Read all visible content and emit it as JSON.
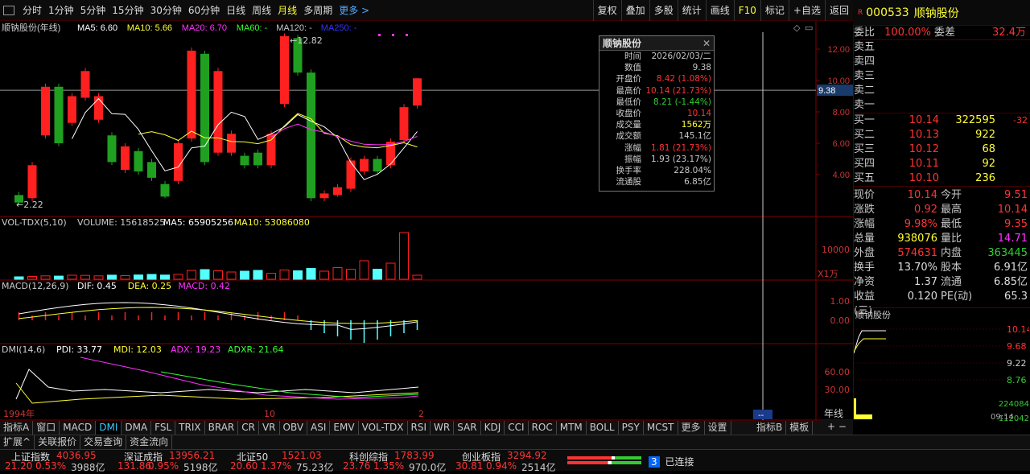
{
  "toolbar": {
    "periods": [
      "分时",
      "1分钟",
      "5分钟",
      "15分钟",
      "30分钟",
      "60分钟",
      "日线",
      "周线",
      "月线",
      "多周期",
      "更多 >"
    ],
    "selected": "月线",
    "tools": [
      "复权",
      "叠加",
      "多股",
      "统计",
      "画线",
      "F10",
      "标记",
      "+自选",
      "返回"
    ]
  },
  "stock": {
    "code": "000533",
    "name": "顺钠股份",
    "flag": "R"
  },
  "main_panel": {
    "title": "顺钠股份(年线)",
    "ma": [
      {
        "label": "MA5: 6.60",
        "color": "#ffffff"
      },
      {
        "label": "MA10: 5.66",
        "color": "#ffff33"
      },
      {
        "label": "MA20: 6.70",
        "color": "#ff33ff"
      },
      {
        "label": "MA60: -",
        "color": "#33ff33"
      },
      {
        "label": "MA120: -",
        "color": "#c8c8c8"
      },
      {
        "label": "MA250: -",
        "color": "#3333ff"
      }
    ],
    "high_label": "12.82",
    "low_label": "2.22",
    "y_ticks": [
      "12.00",
      "10.00",
      "8.00",
      "6.00",
      "4.00"
    ],
    "cursor_price": "9.38"
  },
  "vol_panel": {
    "title": "VOL-TDX(5,10)",
    "items": [
      "VOLUME: 15618525",
      "MA5: 65905256",
      "MA10: 53086080"
    ],
    "y_ticks": [
      "10000"
    ],
    "unit": "X1万"
  },
  "macd_panel": {
    "title": "MACD(12,26,9)",
    "items": [
      "DIF: 0.45",
      "DEA: 0.25",
      "MACD: 0.42"
    ],
    "y_ticks": [
      "1.00",
      "0.00"
    ]
  },
  "dmi_panel": {
    "title": "DMI(14,6)",
    "items": [
      "PDI: 33.77",
      "MDI: 12.03",
      "ADX: 19.23",
      "ADXR: 21.64"
    ],
    "y_ticks": [
      "60.00",
      "30.00"
    ]
  },
  "x_axis": {
    "start": "1994年",
    "mid": "10",
    "end": "2",
    "cursor": "--",
    "period": "年线"
  },
  "popup": {
    "title": "顺钠股份",
    "rows": [
      {
        "k": "时间",
        "v": "2026/02/03/二",
        "c": "#c8c8c8"
      },
      {
        "k": "数值",
        "v": "9.38",
        "c": "#c8c8c8"
      },
      {
        "k": "开盘价",
        "v": "8.42 (1.08%)",
        "c": "#ff3333"
      },
      {
        "k": "最高价",
        "v": "10.14 (21.73%)",
        "c": "#ff3333"
      },
      {
        "k": "最低价",
        "v": "8.21 (-1.44%)",
        "c": "#33cc33"
      },
      {
        "k": "收盘价",
        "v": "10.14",
        "c": "#ff3333"
      },
      {
        "k": "成交量",
        "v": "1562万",
        "c": "#ffff33"
      },
      {
        "k": "成交额",
        "v": "145.1亿",
        "c": "#c8c8c8"
      },
      {
        "k": "涨幅",
        "v": "1.81 (21.73%)",
        "c": "#ff3333"
      },
      {
        "k": "振幅",
        "v": "1.93 (23.17%)",
        "c": "#c8c8c8"
      },
      {
        "k": "换手率",
        "v": "228.04%",
        "c": "#c8c8c8"
      },
      {
        "k": "流通股",
        "v": "6.85亿",
        "c": "#c8c8c8"
      }
    ]
  },
  "orderbook": {
    "wb_label": "委比",
    "wb_val": "100.00%",
    "wc_label": "委差",
    "wc_val": "32.4万",
    "asks": [
      "卖五",
      "卖四",
      "卖三",
      "卖二",
      "卖一"
    ],
    "bids": [
      {
        "l": "买一",
        "p": "10.14",
        "v": "322595",
        "c": "-32"
      },
      {
        "l": "买二",
        "p": "10.13",
        "v": "922",
        "c": ""
      },
      {
        "l": "买三",
        "p": "10.12",
        "v": "68",
        "c": ""
      },
      {
        "l": "买四",
        "p": "10.11",
        "v": "92",
        "c": ""
      },
      {
        "l": "买五",
        "p": "10.10",
        "v": "236",
        "c": ""
      }
    ]
  },
  "quote": [
    {
      "l1": "现价",
      "v1": "10.14",
      "c1": "red",
      "l2": "今开",
      "v2": "9.51",
      "c2": "red"
    },
    {
      "l1": "涨跌",
      "v1": "0.92",
      "c1": "red",
      "l2": "最高",
      "v2": "10.14",
      "c2": "red"
    },
    {
      "l1": "涨幅",
      "v1": "9.98%",
      "c1": "red",
      "l2": "最低",
      "v2": "9.35",
      "c2": "red"
    },
    {
      "l1": "总量",
      "v1": "938076",
      "c1": "yel",
      "l2": "量比",
      "v2": "14.71",
      "c2": "mag"
    },
    {
      "l1": "外盘",
      "v1": "574631",
      "c1": "red",
      "l2": "内盘",
      "v2": "363445",
      "c2": "grn"
    },
    {
      "l1": "换手",
      "v1": "13.70%",
      "c1": "wht",
      "l2": "股本",
      "v2": "6.91亿",
      "c2": "wht"
    },
    {
      "l1": "净资",
      "v1": "1.37",
      "c1": "wht",
      "l2": "流通",
      "v2": "6.85亿",
      "c2": "wht"
    },
    {
      "l1": "收益(三)",
      "v1": "0.120",
      "c1": "wht",
      "l2": "PE(动)",
      "v2": "65.3",
      "c2": "wht"
    }
  ],
  "mini": {
    "title": "顺钠股份",
    "ticks": [
      "10.14",
      "9.68",
      "9.22",
      "8.76"
    ],
    "vol_ticks": [
      "224084",
      "112042"
    ],
    "time": "09:14"
  },
  "tabs": [
    "指标A",
    "窗口",
    "MACD",
    "DMI",
    "DMA",
    "FSL",
    "TRIX",
    "BRAR",
    "CR",
    "VR",
    "OBV",
    "ASI",
    "EMV",
    "VOL-TDX",
    "RSI",
    "WR",
    "SAR",
    "KDJ",
    "CCI",
    "ROC",
    "MTM",
    "BOLL",
    "PSY",
    "MCST",
    "更多",
    "设置"
  ],
  "tab_selected": "DMI",
  "right_tabs": [
    "指标B",
    "模板"
  ],
  "tabs2": [
    "扩展^",
    "关联报价",
    "交易查询",
    "资金流向"
  ],
  "indices": [
    {
      "name": "上证指数",
      "val": "4036.95",
      "chg": "21.20",
      "pct": "0.53%",
      "amt": "3988亿"
    },
    {
      "name": "深证成指",
      "val": "13956.21",
      "chg": "131.86",
      "pct": "0.95%",
      "amt": "5198亿"
    },
    {
      "name": "北证50",
      "val": "1521.03",
      "chg": "20.60",
      "pct": "1.37%",
      "amt": "75.23亿"
    },
    {
      "name": "科创综指",
      "val": "1783.99",
      "chg": "23.76",
      "pct": "1.35%",
      "amt": "970.0亿"
    },
    {
      "name": "创业板指",
      "val": "3294.92",
      "chg": "30.81",
      "pct": "0.94%",
      "amt": "2514亿"
    }
  ],
  "connected": "已连接",
  "connected_num": "3",
  "chart_data": {
    "type": "candlestick",
    "candles": [
      {
        "o": 2.7,
        "c": 2.22,
        "h": 2.9,
        "l": 2.1
      },
      {
        "o": 2.5,
        "c": 4.6,
        "h": 4.8,
        "l": 2.3
      },
      {
        "o": 6.5,
        "c": 9.6,
        "h": 9.8,
        "l": 6.3
      },
      {
        "o": 9.6,
        "c": 6.0,
        "h": 9.8,
        "l": 5.8
      },
      {
        "o": 7.3,
        "c": 9.0,
        "h": 9.2,
        "l": 7.1
      },
      {
        "o": 8.9,
        "c": 10.6,
        "h": 10.8,
        "l": 8.7
      },
      {
        "o": 7.5,
        "c": 9.0,
        "h": 9.2,
        "l": 7.3
      },
      {
        "o": 6.5,
        "c": 4.8,
        "h": 6.7,
        "l": 4.6
      },
      {
        "o": 4.3,
        "c": 5.8,
        "h": 6.0,
        "l": 4.1
      },
      {
        "o": 5.5,
        "c": 4.2,
        "h": 5.7,
        "l": 4.0
      },
      {
        "o": 4.8,
        "c": 3.8,
        "h": 5.0,
        "l": 3.6
      },
      {
        "o": 3.4,
        "c": 2.6,
        "h": 3.6,
        "l": 2.5
      },
      {
        "o": 3.6,
        "c": 6.0,
        "h": 6.2,
        "l": 3.4
      },
      {
        "o": 6.3,
        "c": 11.9,
        "h": 12.1,
        "l": 6.1
      },
      {
        "o": 11.7,
        "c": 4.8,
        "h": 11.9,
        "l": 4.6
      },
      {
        "o": 5.4,
        "c": 10.6,
        "h": 10.8,
        "l": 5.2
      },
      {
        "o": 5.4,
        "c": 6.6,
        "h": 6.8,
        "l": 5.2
      },
      {
        "o": 5.2,
        "c": 4.6,
        "h": 5.4,
        "l": 4.4
      },
      {
        "o": 5.4,
        "c": 4.6,
        "h": 5.6,
        "l": 4.4
      },
      {
        "o": 4.6,
        "c": 6.6,
        "h": 6.8,
        "l": 4.4
      },
      {
        "o": 8.5,
        "c": 12.82,
        "h": 13.0,
        "l": 8.3
      },
      {
        "o": 12.7,
        "c": 10.5,
        "h": 12.9,
        "l": 10.3
      },
      {
        "o": 10.5,
        "c": 2.5,
        "h": 10.7,
        "l": 2.3
      },
      {
        "o": 2.5,
        "c": 2.8,
        "h": 3.0,
        "l": 2.3
      },
      {
        "o": 2.7,
        "c": 3.2,
        "h": 3.4,
        "l": 2.6
      },
      {
        "o": 3.1,
        "c": 4.9,
        "h": 5.1,
        "l": 2.9
      },
      {
        "o": 4.2,
        "c": 5.0,
        "h": 5.2,
        "l": 4.0
      },
      {
        "o": 5.0,
        "c": 4.2,
        "h": 5.2,
        "l": 4.0
      },
      {
        "o": 4.6,
        "c": 6.1,
        "h": 6.3,
        "l": 4.4
      },
      {
        "o": 6.2,
        "c": 8.3,
        "h": 8.5,
        "l": 6.0
      },
      {
        "o": 8.4,
        "c": 10.14,
        "h": 10.14,
        "l": 8.21
      }
    ],
    "volumes": [
      300,
      350,
      420,
      390,
      500,
      480,
      420,
      510,
      450,
      530,
      600,
      520,
      610,
      1100,
      1200,
      1050,
      900,
      1000,
      1100,
      750,
      1150,
      1050,
      1350,
      1000,
      1450,
      1250,
      2300,
      1250,
      2000,
      5800,
      500
    ]
  }
}
